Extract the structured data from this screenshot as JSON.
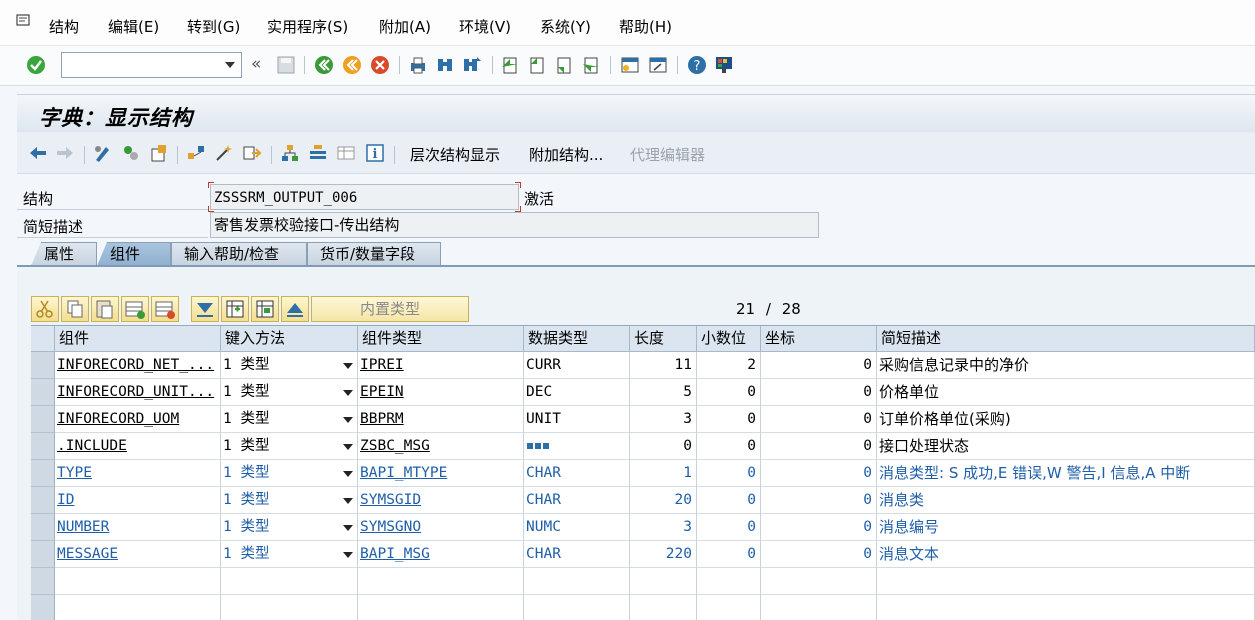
{
  "menu": {
    "items": [
      "结构",
      "编辑(E)",
      "转到(G)",
      "实用程序(S)",
      "附加(A)",
      "环境(V)",
      "系统(Y)",
      "帮助(H)"
    ]
  },
  "toolbar": {
    "command_value": "",
    "icons": [
      "enter-icon",
      "back-arrows-icon",
      "save-icon",
      "back-icon",
      "exit-icon",
      "cancel-icon",
      "print-icon",
      "find-icon",
      "find-next-icon",
      "first-page-icon",
      "prev-page-icon",
      "next-page-icon",
      "last-page-icon",
      "new-session-icon",
      "shortcut-icon",
      "help-icon",
      "customize-layout-icon"
    ]
  },
  "title": "字典：显示结构",
  "app_toolbar": {
    "hierarchy_label": "层次结构显示",
    "append_label": "附加结构...",
    "proxy_editor_label": "代理编辑器"
  },
  "form": {
    "structure_label": "结构",
    "structure_value": "ZSSSRM_OUTPUT_006",
    "status": "激活",
    "short_desc_label": "简短描述",
    "short_desc_value": "寄售发票校验接口-传出结构"
  },
  "tabs": [
    "属性",
    "组件",
    "输入帮助/检查",
    "货币/数量字段"
  ],
  "active_tab": 1,
  "table_toolbar": {
    "builtin_type_label": "内置类型",
    "counter_current": "21",
    "counter_sep": "/",
    "counter_total": "28"
  },
  "table": {
    "headers": [
      "组件",
      "键入方法",
      "组件类型",
      "数据类型",
      "长度",
      "小数位",
      "坐标",
      "简短描述"
    ],
    "rows": [
      {
        "component": "INFORECORD_NET_...",
        "typing": "1 类型",
        "comp_type": "IPREI",
        "data_type": "CURR",
        "length": "11",
        "decimals": "2",
        "coord": "0",
        "desc": "采购信息记录中的净价",
        "blue": false
      },
      {
        "component": "INFORECORD_UNIT...",
        "typing": "1 类型",
        "comp_type": "EPEIN",
        "data_type": "DEC",
        "length": "5",
        "decimals": "0",
        "coord": "0",
        "desc": "价格单位",
        "blue": false
      },
      {
        "component": "INFORECORD_UOM",
        "typing": "1 类型",
        "comp_type": "BBPRM",
        "data_type": "UNIT",
        "length": "3",
        "decimals": "0",
        "coord": "0",
        "desc": "订单价格单位(采购)",
        "blue": false
      },
      {
        "component": ".INCLUDE",
        "typing": "1 类型",
        "comp_type": "ZSBC_MSG",
        "data_type": "",
        "length": "0",
        "decimals": "0",
        "coord": "0",
        "desc": "接口处理状态",
        "blue": false,
        "struct_icon": true
      },
      {
        "component": "TYPE",
        "typing": "1 类型",
        "comp_type": "BAPI_MTYPE",
        "data_type": "CHAR",
        "length": "1",
        "decimals": "0",
        "coord": "0",
        "desc": "消息类型: S 成功,E 错误,W 警告,I 信息,A 中断",
        "blue": true
      },
      {
        "component": "ID",
        "typing": "1 类型",
        "comp_type": "SYMSGID",
        "data_type": "CHAR",
        "length": "20",
        "decimals": "0",
        "coord": "0",
        "desc": "消息类",
        "blue": true
      },
      {
        "component": "NUMBER",
        "typing": "1 类型",
        "comp_type": "SYMSGNO",
        "data_type": "NUMC",
        "length": "3",
        "decimals": "0",
        "coord": "0",
        "desc": "消息编号",
        "blue": true
      },
      {
        "component": "MESSAGE",
        "typing": "1 类型",
        "comp_type": "BAPI_MSG",
        "data_type": "CHAR",
        "length": "220",
        "decimals": "0",
        "coord": "0",
        "desc": "消息文本",
        "blue": true
      }
    ]
  },
  "colors": {
    "included_text": "#1f5ea8",
    "header_bg": "#dbe5ef",
    "active_tab": "#8fb0d0"
  }
}
